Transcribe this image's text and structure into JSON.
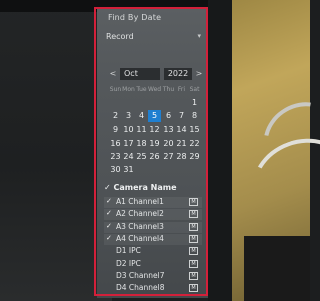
{
  "dialog": {
    "title": "Find By Date",
    "record_type": "Record"
  },
  "calendar": {
    "prev_label": "<",
    "next_label": ">",
    "month": "Oct",
    "year": "2022",
    "weekdays": [
      "Sun",
      "Mon",
      "Tue",
      "Wed",
      "Thu",
      "Fri",
      "Sat"
    ],
    "selected_day": "5",
    "weeks": [
      [
        "",
        "",
        "",
        "",
        "",
        "",
        "1"
      ],
      [
        "2",
        "3",
        "4",
        "5",
        "6",
        "7",
        "8"
      ],
      [
        "9",
        "10",
        "11",
        "12",
        "13",
        "14",
        "15"
      ],
      [
        "16",
        "17",
        "18",
        "19",
        "20",
        "21",
        "22"
      ],
      [
        "23",
        "24",
        "25",
        "26",
        "27",
        "28",
        "29"
      ],
      [
        "30",
        "31",
        "",
        "",
        "",
        "",
        ""
      ]
    ]
  },
  "cameras": {
    "header": "Camera Name",
    "items": [
      {
        "check": "✓",
        "name": "A1 Channel1",
        "tag": "M"
      },
      {
        "check": "✓",
        "name": "A2 Channel2",
        "tag": "M"
      },
      {
        "check": "✓",
        "name": "A3 Channel3",
        "tag": "M"
      },
      {
        "check": "✓",
        "name": "A4 Channel4",
        "tag": "M"
      },
      {
        "check": "",
        "name": "D1 IPC",
        "tag": "M"
      },
      {
        "check": "",
        "name": "D2 IPC",
        "tag": "M"
      },
      {
        "check": "",
        "name": "D3 Channel7",
        "tag": "M"
      },
      {
        "check": "",
        "name": "D4 Channel8",
        "tag": "M"
      }
    ]
  },
  "colors": {
    "highlight_border": "#d3203a",
    "selected_day": "#1f7fd0"
  }
}
